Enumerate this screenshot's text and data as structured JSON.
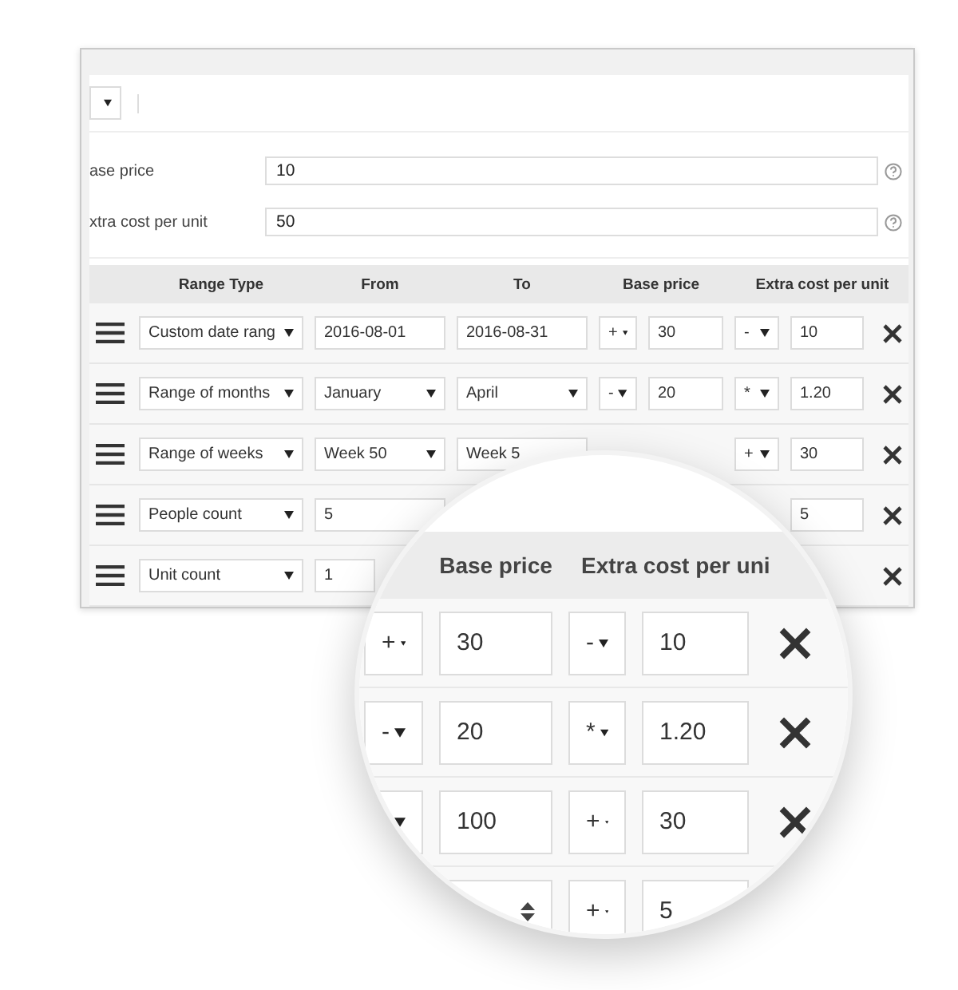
{
  "top_bar": {
    "select": {
      "kind": "select"
    }
  },
  "settings": [
    {
      "label": "ase price",
      "value": "10"
    },
    {
      "label": "xtra cost per unit",
      "value": "50"
    }
  ],
  "table": {
    "columns": [
      "Range Type",
      "From",
      "To",
      "Base price",
      "Extra cost per unit"
    ],
    "rows": [
      {
        "range_type": {
          "kind": "select",
          "value": "Custom date rang"
        },
        "from": {
          "kind": "input",
          "value": "2016-08-01"
        },
        "to": {
          "kind": "input",
          "value": "2016-08-31"
        },
        "base_sign": {
          "kind": "select",
          "value": "+"
        },
        "base_price": {
          "kind": "input",
          "value": "30"
        },
        "extra_sign": {
          "kind": "select",
          "value": "-"
        },
        "extra_cost": {
          "kind": "input",
          "value": "10"
        },
        "remove_button": true
      },
      {
        "range_type": {
          "kind": "select",
          "value": "Range of months"
        },
        "from": {
          "kind": "select",
          "value": "January"
        },
        "to": {
          "kind": "select",
          "value": "April"
        },
        "base_sign": {
          "kind": "select",
          "value": "-"
        },
        "base_price": {
          "kind": "input",
          "value": "20"
        },
        "extra_sign": {
          "kind": "select",
          "value": "*"
        },
        "extra_cost": {
          "kind": "input",
          "value": "1.20"
        },
        "remove_button": true
      },
      {
        "range_type": {
          "kind": "select",
          "value": "Range of weeks"
        },
        "from": {
          "kind": "select",
          "value": "Week 50"
        },
        "to": {
          "kind": "input",
          "value": "Week 5"
        },
        "extra_sign": {
          "kind": "select",
          "value": "+"
        },
        "extra_cost": {
          "kind": "input",
          "value": "30"
        },
        "remove_button": true
      },
      {
        "range_type": {
          "kind": "select",
          "value": "People count"
        },
        "from": {
          "kind": "input",
          "value": "5"
        },
        "extra_cost": {
          "kind": "input",
          "value": "5"
        },
        "remove_button": true
      },
      {
        "range_type": {
          "kind": "select",
          "value": "Unit count"
        },
        "from": {
          "kind": "input",
          "value": "1"
        },
        "remove_button": true
      }
    ]
  },
  "magnifier": {
    "columns": [
      "Base price",
      "Extra cost per uni"
    ],
    "rows": [
      {
        "base_sign": {
          "kind": "select",
          "value": "+"
        },
        "base_price": {
          "kind": "input",
          "value": "30"
        },
        "extra_sign": {
          "kind": "select",
          "value": "-"
        },
        "extra_cost": {
          "kind": "input",
          "value": "10"
        },
        "remove_button": true
      },
      {
        "base_sign": {
          "kind": "select",
          "value": "-"
        },
        "base_price": {
          "kind": "input",
          "value": "20"
        },
        "extra_sign": {
          "kind": "select",
          "value": "*"
        },
        "extra_cost": {
          "kind": "input",
          "value": "1.20"
        },
        "remove_button": true
      },
      {
        "base_sign": {
          "kind": "select"
        },
        "base_price": {
          "kind": "input",
          "value": "100"
        },
        "extra_sign": {
          "kind": "select",
          "value": "+"
        },
        "extra_cost": {
          "kind": "input",
          "value": "30"
        },
        "remove_button": true
      },
      {
        "base_price": {
          "kind": "number"
        },
        "extra_sign": {
          "kind": "select",
          "value": "+"
        },
        "extra_cost": {
          "kind": "input",
          "value": "5"
        }
      }
    ]
  }
}
